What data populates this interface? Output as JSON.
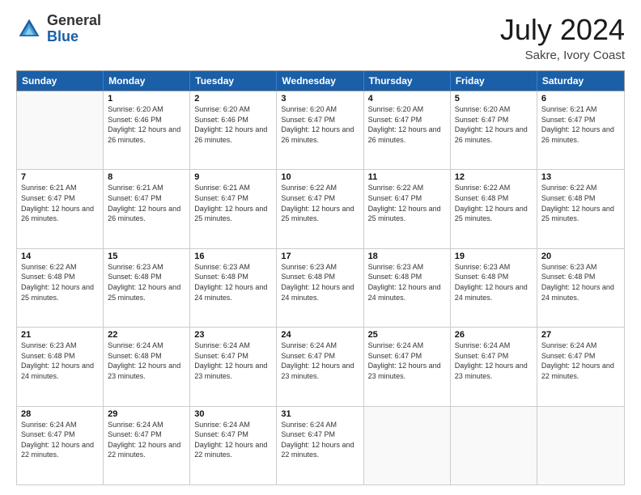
{
  "header": {
    "logo_general": "General",
    "logo_blue": "Blue",
    "month_title": "July 2024",
    "location": "Sakre, Ivory Coast"
  },
  "weekdays": [
    "Sunday",
    "Monday",
    "Tuesday",
    "Wednesday",
    "Thursday",
    "Friday",
    "Saturday"
  ],
  "weeks": [
    [
      {
        "day": "",
        "empty": true
      },
      {
        "day": "1",
        "sunrise": "Sunrise: 6:20 AM",
        "sunset": "Sunset: 6:46 PM",
        "daylight": "Daylight: 12 hours and 26 minutes."
      },
      {
        "day": "2",
        "sunrise": "Sunrise: 6:20 AM",
        "sunset": "Sunset: 6:46 PM",
        "daylight": "Daylight: 12 hours and 26 minutes."
      },
      {
        "day": "3",
        "sunrise": "Sunrise: 6:20 AM",
        "sunset": "Sunset: 6:47 PM",
        "daylight": "Daylight: 12 hours and 26 minutes."
      },
      {
        "day": "4",
        "sunrise": "Sunrise: 6:20 AM",
        "sunset": "Sunset: 6:47 PM",
        "daylight": "Daylight: 12 hours and 26 minutes."
      },
      {
        "day": "5",
        "sunrise": "Sunrise: 6:20 AM",
        "sunset": "Sunset: 6:47 PM",
        "daylight": "Daylight: 12 hours and 26 minutes."
      },
      {
        "day": "6",
        "sunrise": "Sunrise: 6:21 AM",
        "sunset": "Sunset: 6:47 PM",
        "daylight": "Daylight: 12 hours and 26 minutes."
      }
    ],
    [
      {
        "day": "7",
        "sunrise": "Sunrise: 6:21 AM",
        "sunset": "Sunset: 6:47 PM",
        "daylight": "Daylight: 12 hours and 26 minutes."
      },
      {
        "day": "8",
        "sunrise": "Sunrise: 6:21 AM",
        "sunset": "Sunset: 6:47 PM",
        "daylight": "Daylight: 12 hours and 26 minutes."
      },
      {
        "day": "9",
        "sunrise": "Sunrise: 6:21 AM",
        "sunset": "Sunset: 6:47 PM",
        "daylight": "Daylight: 12 hours and 25 minutes."
      },
      {
        "day": "10",
        "sunrise": "Sunrise: 6:22 AM",
        "sunset": "Sunset: 6:47 PM",
        "daylight": "Daylight: 12 hours and 25 minutes."
      },
      {
        "day": "11",
        "sunrise": "Sunrise: 6:22 AM",
        "sunset": "Sunset: 6:47 PM",
        "daylight": "Daylight: 12 hours and 25 minutes."
      },
      {
        "day": "12",
        "sunrise": "Sunrise: 6:22 AM",
        "sunset": "Sunset: 6:48 PM",
        "daylight": "Daylight: 12 hours and 25 minutes."
      },
      {
        "day": "13",
        "sunrise": "Sunrise: 6:22 AM",
        "sunset": "Sunset: 6:48 PM",
        "daylight": "Daylight: 12 hours and 25 minutes."
      }
    ],
    [
      {
        "day": "14",
        "sunrise": "Sunrise: 6:22 AM",
        "sunset": "Sunset: 6:48 PM",
        "daylight": "Daylight: 12 hours and 25 minutes."
      },
      {
        "day": "15",
        "sunrise": "Sunrise: 6:23 AM",
        "sunset": "Sunset: 6:48 PM",
        "daylight": "Daylight: 12 hours and 25 minutes."
      },
      {
        "day": "16",
        "sunrise": "Sunrise: 6:23 AM",
        "sunset": "Sunset: 6:48 PM",
        "daylight": "Daylight: 12 hours and 24 minutes."
      },
      {
        "day": "17",
        "sunrise": "Sunrise: 6:23 AM",
        "sunset": "Sunset: 6:48 PM",
        "daylight": "Daylight: 12 hours and 24 minutes."
      },
      {
        "day": "18",
        "sunrise": "Sunrise: 6:23 AM",
        "sunset": "Sunset: 6:48 PM",
        "daylight": "Daylight: 12 hours and 24 minutes."
      },
      {
        "day": "19",
        "sunrise": "Sunrise: 6:23 AM",
        "sunset": "Sunset: 6:48 PM",
        "daylight": "Daylight: 12 hours and 24 minutes."
      },
      {
        "day": "20",
        "sunrise": "Sunrise: 6:23 AM",
        "sunset": "Sunset: 6:48 PM",
        "daylight": "Daylight: 12 hours and 24 minutes."
      }
    ],
    [
      {
        "day": "21",
        "sunrise": "Sunrise: 6:23 AM",
        "sunset": "Sunset: 6:48 PM",
        "daylight": "Daylight: 12 hours and 24 minutes."
      },
      {
        "day": "22",
        "sunrise": "Sunrise: 6:24 AM",
        "sunset": "Sunset: 6:48 PM",
        "daylight": "Daylight: 12 hours and 23 minutes."
      },
      {
        "day": "23",
        "sunrise": "Sunrise: 6:24 AM",
        "sunset": "Sunset: 6:47 PM",
        "daylight": "Daylight: 12 hours and 23 minutes."
      },
      {
        "day": "24",
        "sunrise": "Sunrise: 6:24 AM",
        "sunset": "Sunset: 6:47 PM",
        "daylight": "Daylight: 12 hours and 23 minutes."
      },
      {
        "day": "25",
        "sunrise": "Sunrise: 6:24 AM",
        "sunset": "Sunset: 6:47 PM",
        "daylight": "Daylight: 12 hours and 23 minutes."
      },
      {
        "day": "26",
        "sunrise": "Sunrise: 6:24 AM",
        "sunset": "Sunset: 6:47 PM",
        "daylight": "Daylight: 12 hours and 23 minutes."
      },
      {
        "day": "27",
        "sunrise": "Sunrise: 6:24 AM",
        "sunset": "Sunset: 6:47 PM",
        "daylight": "Daylight: 12 hours and 22 minutes."
      }
    ],
    [
      {
        "day": "28",
        "sunrise": "Sunrise: 6:24 AM",
        "sunset": "Sunset: 6:47 PM",
        "daylight": "Daylight: 12 hours and 22 minutes."
      },
      {
        "day": "29",
        "sunrise": "Sunrise: 6:24 AM",
        "sunset": "Sunset: 6:47 PM",
        "daylight": "Daylight: 12 hours and 22 minutes."
      },
      {
        "day": "30",
        "sunrise": "Sunrise: 6:24 AM",
        "sunset": "Sunset: 6:47 PM",
        "daylight": "Daylight: 12 hours and 22 minutes."
      },
      {
        "day": "31",
        "sunrise": "Sunrise: 6:24 AM",
        "sunset": "Sunset: 6:47 PM",
        "daylight": "Daylight: 12 hours and 22 minutes."
      },
      {
        "day": "",
        "empty": true
      },
      {
        "day": "",
        "empty": true
      },
      {
        "day": "",
        "empty": true
      }
    ]
  ]
}
